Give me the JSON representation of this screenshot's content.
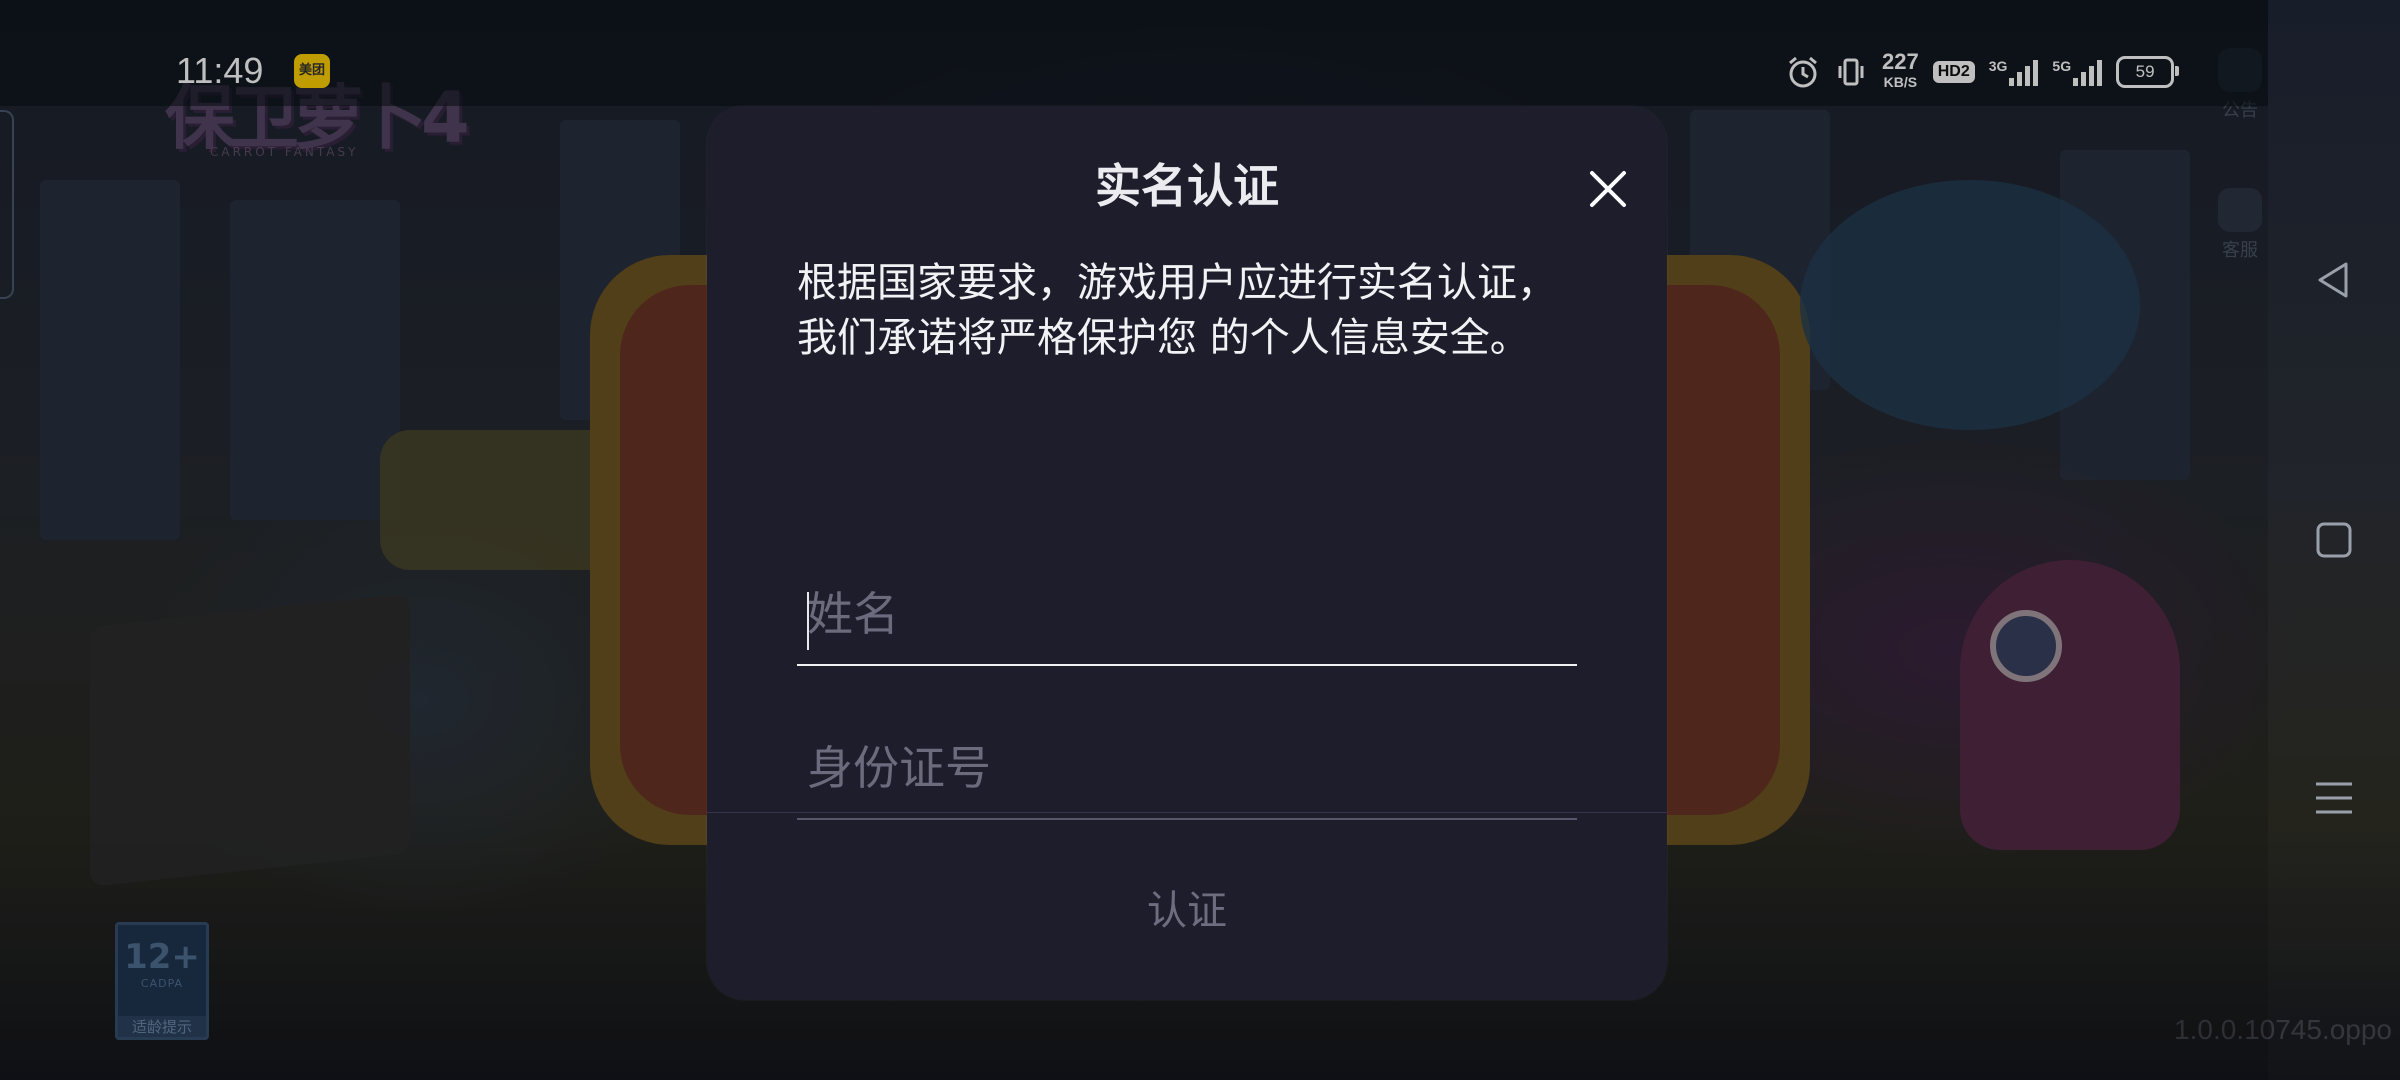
{
  "status_bar": {
    "time": "11:49",
    "app_badge": "美团",
    "net_speed": "227",
    "net_speed_unit": "KB/S",
    "hd_label": "HD2",
    "network_1": "3G",
    "network_2": "5G",
    "battery": "59"
  },
  "game": {
    "logo": "保卫萝卜4",
    "logo_sub": "CARROT FANTASY",
    "notice_label": "公告",
    "service_label": "客服",
    "age_rating": "12+",
    "age_org": "CADPA",
    "age_tip": "适龄提示",
    "version": "1.0.0.10745.oppo"
  },
  "dialog": {
    "title": "实名认证",
    "description": "根据国家要求，游戏用户应进行实名认证，我们承诺将严格保护您 的个人信息安全。",
    "name_placeholder": "姓名",
    "name_value": "",
    "id_placeholder": "身份证号",
    "id_value": "",
    "submit_label": "认证"
  },
  "colors": {
    "dialog_bg": "#1e1d2c",
    "text_primary": "#f2f2f5",
    "placeholder": "#6c6b7e",
    "button_disabled": "#6e6d80"
  }
}
